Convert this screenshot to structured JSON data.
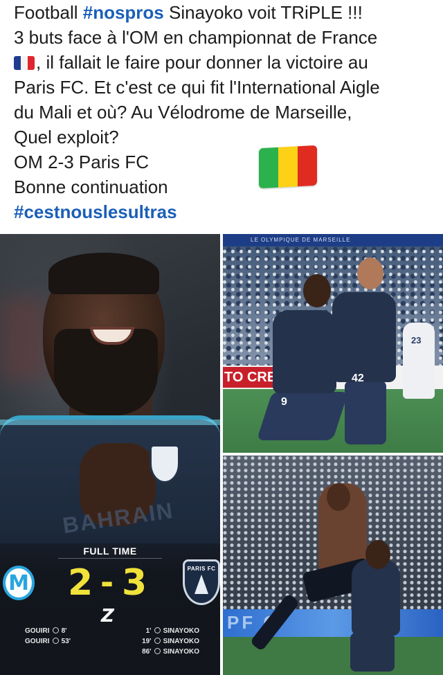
{
  "post": {
    "line1_prefix": "Football ",
    "hashtag1": "#nospros",
    "line1_suffix": " Sinayoko voit TRiPLE !!!",
    "line2": "3 buts face à l'OM en championnat de France",
    "line3": ", il fallait le faire pour donner la victoire au",
    "line4": "Paris FC. Et c'est ce qui fit l'International Aigle",
    "line5": "du Mali et où? Au Vélodrome de Marseille,",
    "line6": "Quel exploit?",
    "line7": "OM 2-3 Paris FC",
    "line8": "Bonne continuation",
    "hashtag2": "#cestnouslesultras",
    "flag_france": "flag-france-emoji",
    "flag_mali": "flag-mali-emoji"
  },
  "scoreboard": {
    "status": "FULL TIME",
    "home_score": "2",
    "dash": "-",
    "away_score": "3",
    "home_logo": "M",
    "away_logo": "PARIS FC",
    "league_mark": "Z",
    "home_scorers": [
      {
        "name": "GOUIRI",
        "minute": "8'"
      },
      {
        "name": "GOUIRI",
        "minute": "53'"
      }
    ],
    "away_scorers": [
      {
        "minute": "1'",
        "name": "SINAYOKO"
      },
      {
        "minute": "19'",
        "name": "SINAYOKO"
      },
      {
        "minute": "86'",
        "name": "SINAYOKO"
      }
    ]
  },
  "photos": {
    "main_sponsor": "BAHRAIN",
    "tr_banner": "LE OLYMPIQUE DE MARSEILLE",
    "tr_board": "TO CREA",
    "tr_numbers": [
      "9",
      "42",
      "23"
    ],
    "br_adboard": "PF C"
  },
  "colors": {
    "hashtag": "#1b5fb8",
    "score_yellow": "#f0e23a",
    "om_blue": "#2aa5df"
  }
}
